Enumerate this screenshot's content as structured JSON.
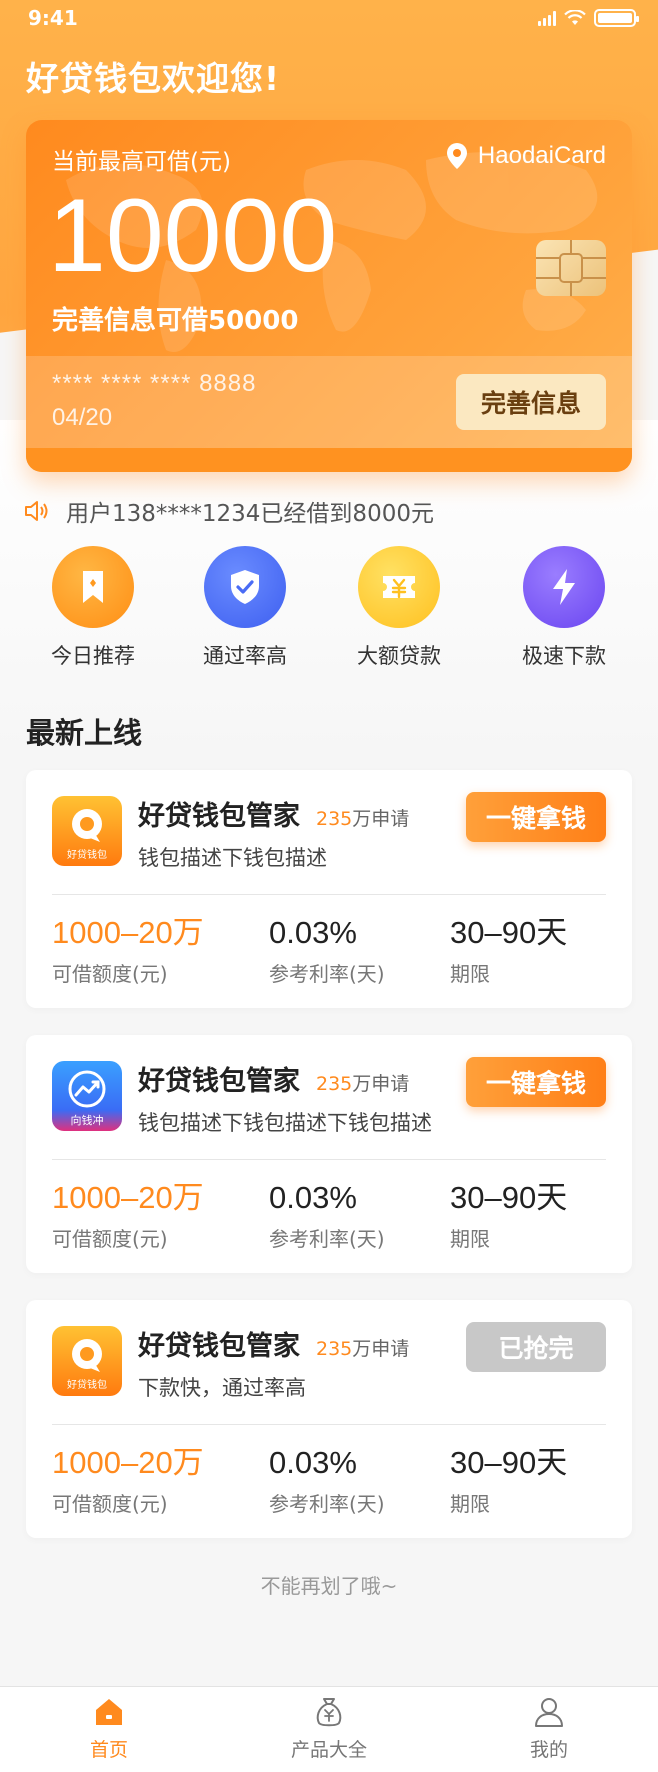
{
  "status_bar": {
    "time": "9:41"
  },
  "header": {
    "welcome": "好贷钱包欢迎您!"
  },
  "card": {
    "label": "当前最高可借(元)",
    "brand": "HaodaiCard",
    "amount": "10000",
    "upgrade_text": "完善信息可借50000",
    "card_number": "**** **** **** 8888",
    "expiry": "04/20",
    "complete_button": "完善信息"
  },
  "notice": {
    "text": "用户138****1234已经借到8000元"
  },
  "quick_actions": [
    {
      "label": "今日推荐",
      "icon": "bookmark-icon",
      "color": "#ff9a1f"
    },
    {
      "label": "通过率高",
      "icon": "shield-check-icon",
      "color": "#4a6cf5"
    },
    {
      "label": "大额贷款",
      "icon": "yuan-ticket-icon",
      "color": "#ffc52a"
    },
    {
      "label": "极速下款",
      "icon": "lightning-icon",
      "color": "#7c5cf6"
    }
  ],
  "section": {
    "title": "最新上线"
  },
  "products": [
    {
      "name": "好贷钱包管家",
      "apply_count": "235",
      "apply_suffix": "万申请",
      "desc": "钱包描述下钱包描述",
      "logo_text": "好贷钱包",
      "cta": "一键拿钱",
      "amount": "1000–20万",
      "amount_label": "可借额度(元)",
      "rate": "0.03%",
      "rate_label": "参考利率(天)",
      "term": "30–90天",
      "term_label": "期限"
    },
    {
      "name": "好贷钱包管家",
      "apply_count": "235",
      "apply_suffix": "万申请",
      "desc": "钱包描述下钱包描述下钱包描述",
      "logo_text": "向钱冲",
      "cta": "一键拿钱",
      "amount": "1000–20万",
      "amount_label": "可借额度(元)",
      "rate": "0.03%",
      "rate_label": "参考利率(天)",
      "term": "30–90天",
      "term_label": "期限"
    },
    {
      "name": "好贷钱包管家",
      "apply_count": "235",
      "apply_suffix": "万申请",
      "desc": "下款快，通过率高",
      "logo_text": "好贷钱包",
      "cta": "已抢完",
      "amount": "1000–20万",
      "amount_label": "可借额度(元)",
      "rate": "0.03%",
      "rate_label": "参考利率(天)",
      "term": "30–90天",
      "term_label": "期限"
    }
  ],
  "footer_note": "不能再划了哦~",
  "tabbar": [
    {
      "label": "首页",
      "icon": "home-icon",
      "active": true
    },
    {
      "label": "产品大全",
      "icon": "money-bag-icon",
      "active": false
    },
    {
      "label": "我的",
      "icon": "user-icon",
      "active": false
    }
  ],
  "colors": {
    "accent": "#ff8a1e",
    "disabled": "#c8c8c8"
  }
}
